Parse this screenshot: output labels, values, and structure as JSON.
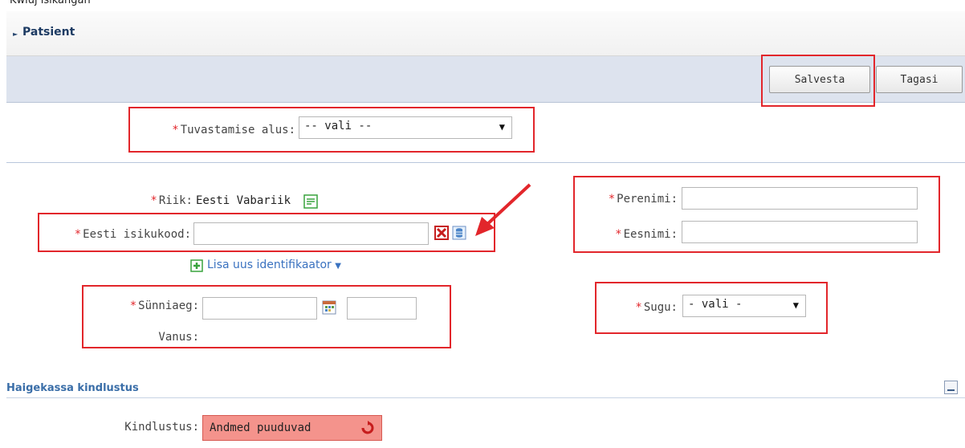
{
  "top_text": "Kwiuj isikangan",
  "section": {
    "title": "Patsient",
    "arrow_icon": "triangle-right-icon"
  },
  "toolbar": {
    "save_label": "Salvesta",
    "back_label": "Tagasi"
  },
  "identification": {
    "label": "Tuvastamise alus:",
    "selected": "-- vali --"
  },
  "country": {
    "label": "Riik:",
    "value": "Eesti Vabariik"
  },
  "personal_code": {
    "label": "Eesti isikukood:",
    "value": ""
  },
  "add_identifier": {
    "label": "Lisa uus identifikaator"
  },
  "surname": {
    "label": "Perenimi:",
    "value": ""
  },
  "firstname": {
    "label": "Eesnimi:",
    "value": ""
  },
  "birth": {
    "label": "Sünniaeg:",
    "date_value": "",
    "time_value": ""
  },
  "age": {
    "label": "Vanus:"
  },
  "gender": {
    "label": "Sugu:",
    "selected": "- vali -"
  },
  "insurance": {
    "section_title": "Haigekassa kindlustus",
    "label": "Kindlustus:",
    "status": "Andmed puuduvad"
  },
  "colors": {
    "accent": "#1d3b63",
    "highlight": "#e2262b",
    "badge": "#f4938c"
  }
}
